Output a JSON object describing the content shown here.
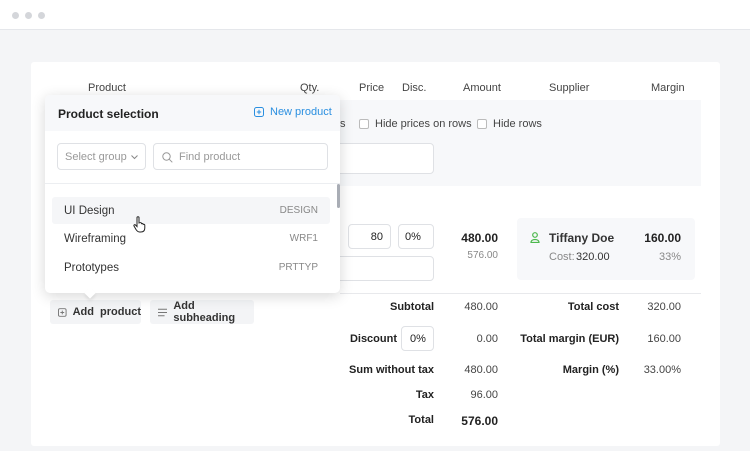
{
  "table_headers": {
    "product": "Product",
    "qty": "Qty.",
    "price": "Price",
    "disc": "Disc.",
    "amount": "Amount",
    "supplier": "Supplier",
    "margin": "Margin"
  },
  "options": {
    "partial_label": "s",
    "hide_prices": "Hide prices on rows",
    "hide_rows": "Hide rows"
  },
  "row": {
    "qty": "80",
    "disc": "0%",
    "amount": "480.00",
    "amount_with_tax": "576.00",
    "supplier_name": "Tiffany Doe",
    "supplier_margin": "160.00",
    "cost_label": "Cost:",
    "cost": "320.00",
    "margin_pct": "33%"
  },
  "actions": {
    "add_product": "Add  product",
    "add_subheading": "Add subheading"
  },
  "summary": {
    "subtotal_label": "Subtotal",
    "subtotal": "480.00",
    "discount_label": "Discount",
    "discount_input": "0%",
    "discount": "0.00",
    "sum_wo_tax_label": "Sum without tax",
    "sum_wo_tax": "480.00",
    "tax_label": "Tax",
    "tax": "96.00",
    "total_label": "Total",
    "total": "576.00",
    "total_cost_label": "Total cost",
    "total_cost": "320.00",
    "total_margin_label": "Total margin (EUR)",
    "total_margin": "160.00",
    "margin_pct_label": "Margin (%)",
    "margin_pct": "33.00%"
  },
  "popup": {
    "title": "Product selection",
    "new_product": "New product",
    "group_placeholder": "Select group",
    "search_placeholder": "Find product",
    "items": [
      {
        "name": "UI Design",
        "code": "DESIGN"
      },
      {
        "name": "Wireframing",
        "code": "WRF1"
      },
      {
        "name": "Prototypes",
        "code": "PRTTYP"
      }
    ]
  },
  "colors": {
    "accent": "#2a8fe0",
    "supplier_icon": "#4cb84c"
  }
}
